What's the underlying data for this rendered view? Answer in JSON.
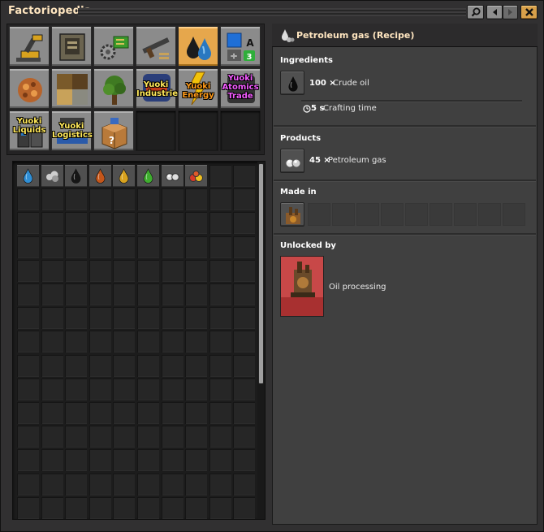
{
  "window": {
    "title": "Factoriopedia"
  },
  "titlebar": {
    "search_icon": "magnifier-icon",
    "back_icon": "arrow-left-icon",
    "forward_icon": "arrow-right-icon",
    "close_icon": "close-icon"
  },
  "categories": [
    {
      "icon": "logistics-inserter-icon",
      "label": ""
    },
    {
      "icon": "production-assembler-icon",
      "label": ""
    },
    {
      "icon": "intermediate-gears-circuit-icon",
      "label": ""
    },
    {
      "icon": "combat-gun-icon",
      "label": ""
    },
    {
      "icon": "fluids-drops-icon",
      "label": "",
      "selected": true
    },
    {
      "icon": "signals-icon",
      "label": ""
    },
    {
      "icon": "enemies-spawner-icon",
      "label": ""
    },
    {
      "icon": "tiles-icon",
      "label": ""
    },
    {
      "icon": "environment-tree-icon",
      "label": ""
    },
    {
      "icon": "yuoki-industries-icon",
      "label": "Yuoki Industries"
    },
    {
      "icon": "yuoki-energy-icon",
      "label": "Yuoki Energy"
    },
    {
      "icon": "yuoki-atomics-trade-icon",
      "label": "Yuoki Atomics Trade"
    },
    {
      "icon": "yuoki-liquids-icon",
      "label": "Yuoki Liquids"
    },
    {
      "icon": "yuoki-logistics-icon",
      "label": "Yuoki Logistics"
    },
    {
      "icon": "unsorted-box-icon",
      "label": ""
    }
  ],
  "items": [
    {
      "icon": "water-drop-icon",
      "color": "#2f8fd6"
    },
    {
      "icon": "steam-cloud-icon",
      "color": "#cfcfcf"
    },
    {
      "icon": "crude-oil-drop-icon",
      "color": "#161616"
    },
    {
      "icon": "heavy-oil-drop-icon",
      "color": "#c4561a"
    },
    {
      "icon": "light-oil-drop-icon",
      "color": "#d8a21e"
    },
    {
      "icon": "lubricant-drop-icon",
      "color": "#3fae2f"
    },
    {
      "icon": "petroleum-gas-icon",
      "color": "#e0e0e0"
    },
    {
      "icon": "sulfuric-acid-icon",
      "color": "#d83a2a"
    }
  ],
  "recipe": {
    "title": "Petroleum gas (Recipe)",
    "ingredients_heading": "Ingredients",
    "ingredient": {
      "amount": "100 ×",
      "name": "Crude oil"
    },
    "crafting": {
      "time": "5 s",
      "label": "Crafting time"
    },
    "products_heading": "Products",
    "product": {
      "amount": "45 ×",
      "name": "Petroleum gas"
    },
    "made_in_heading": "Made in",
    "unlocked_heading": "Unlocked by",
    "technology": {
      "name": "Oil processing"
    }
  },
  "colors": {
    "accent": "#e6a74c",
    "heading": "#ffe6c0"
  }
}
